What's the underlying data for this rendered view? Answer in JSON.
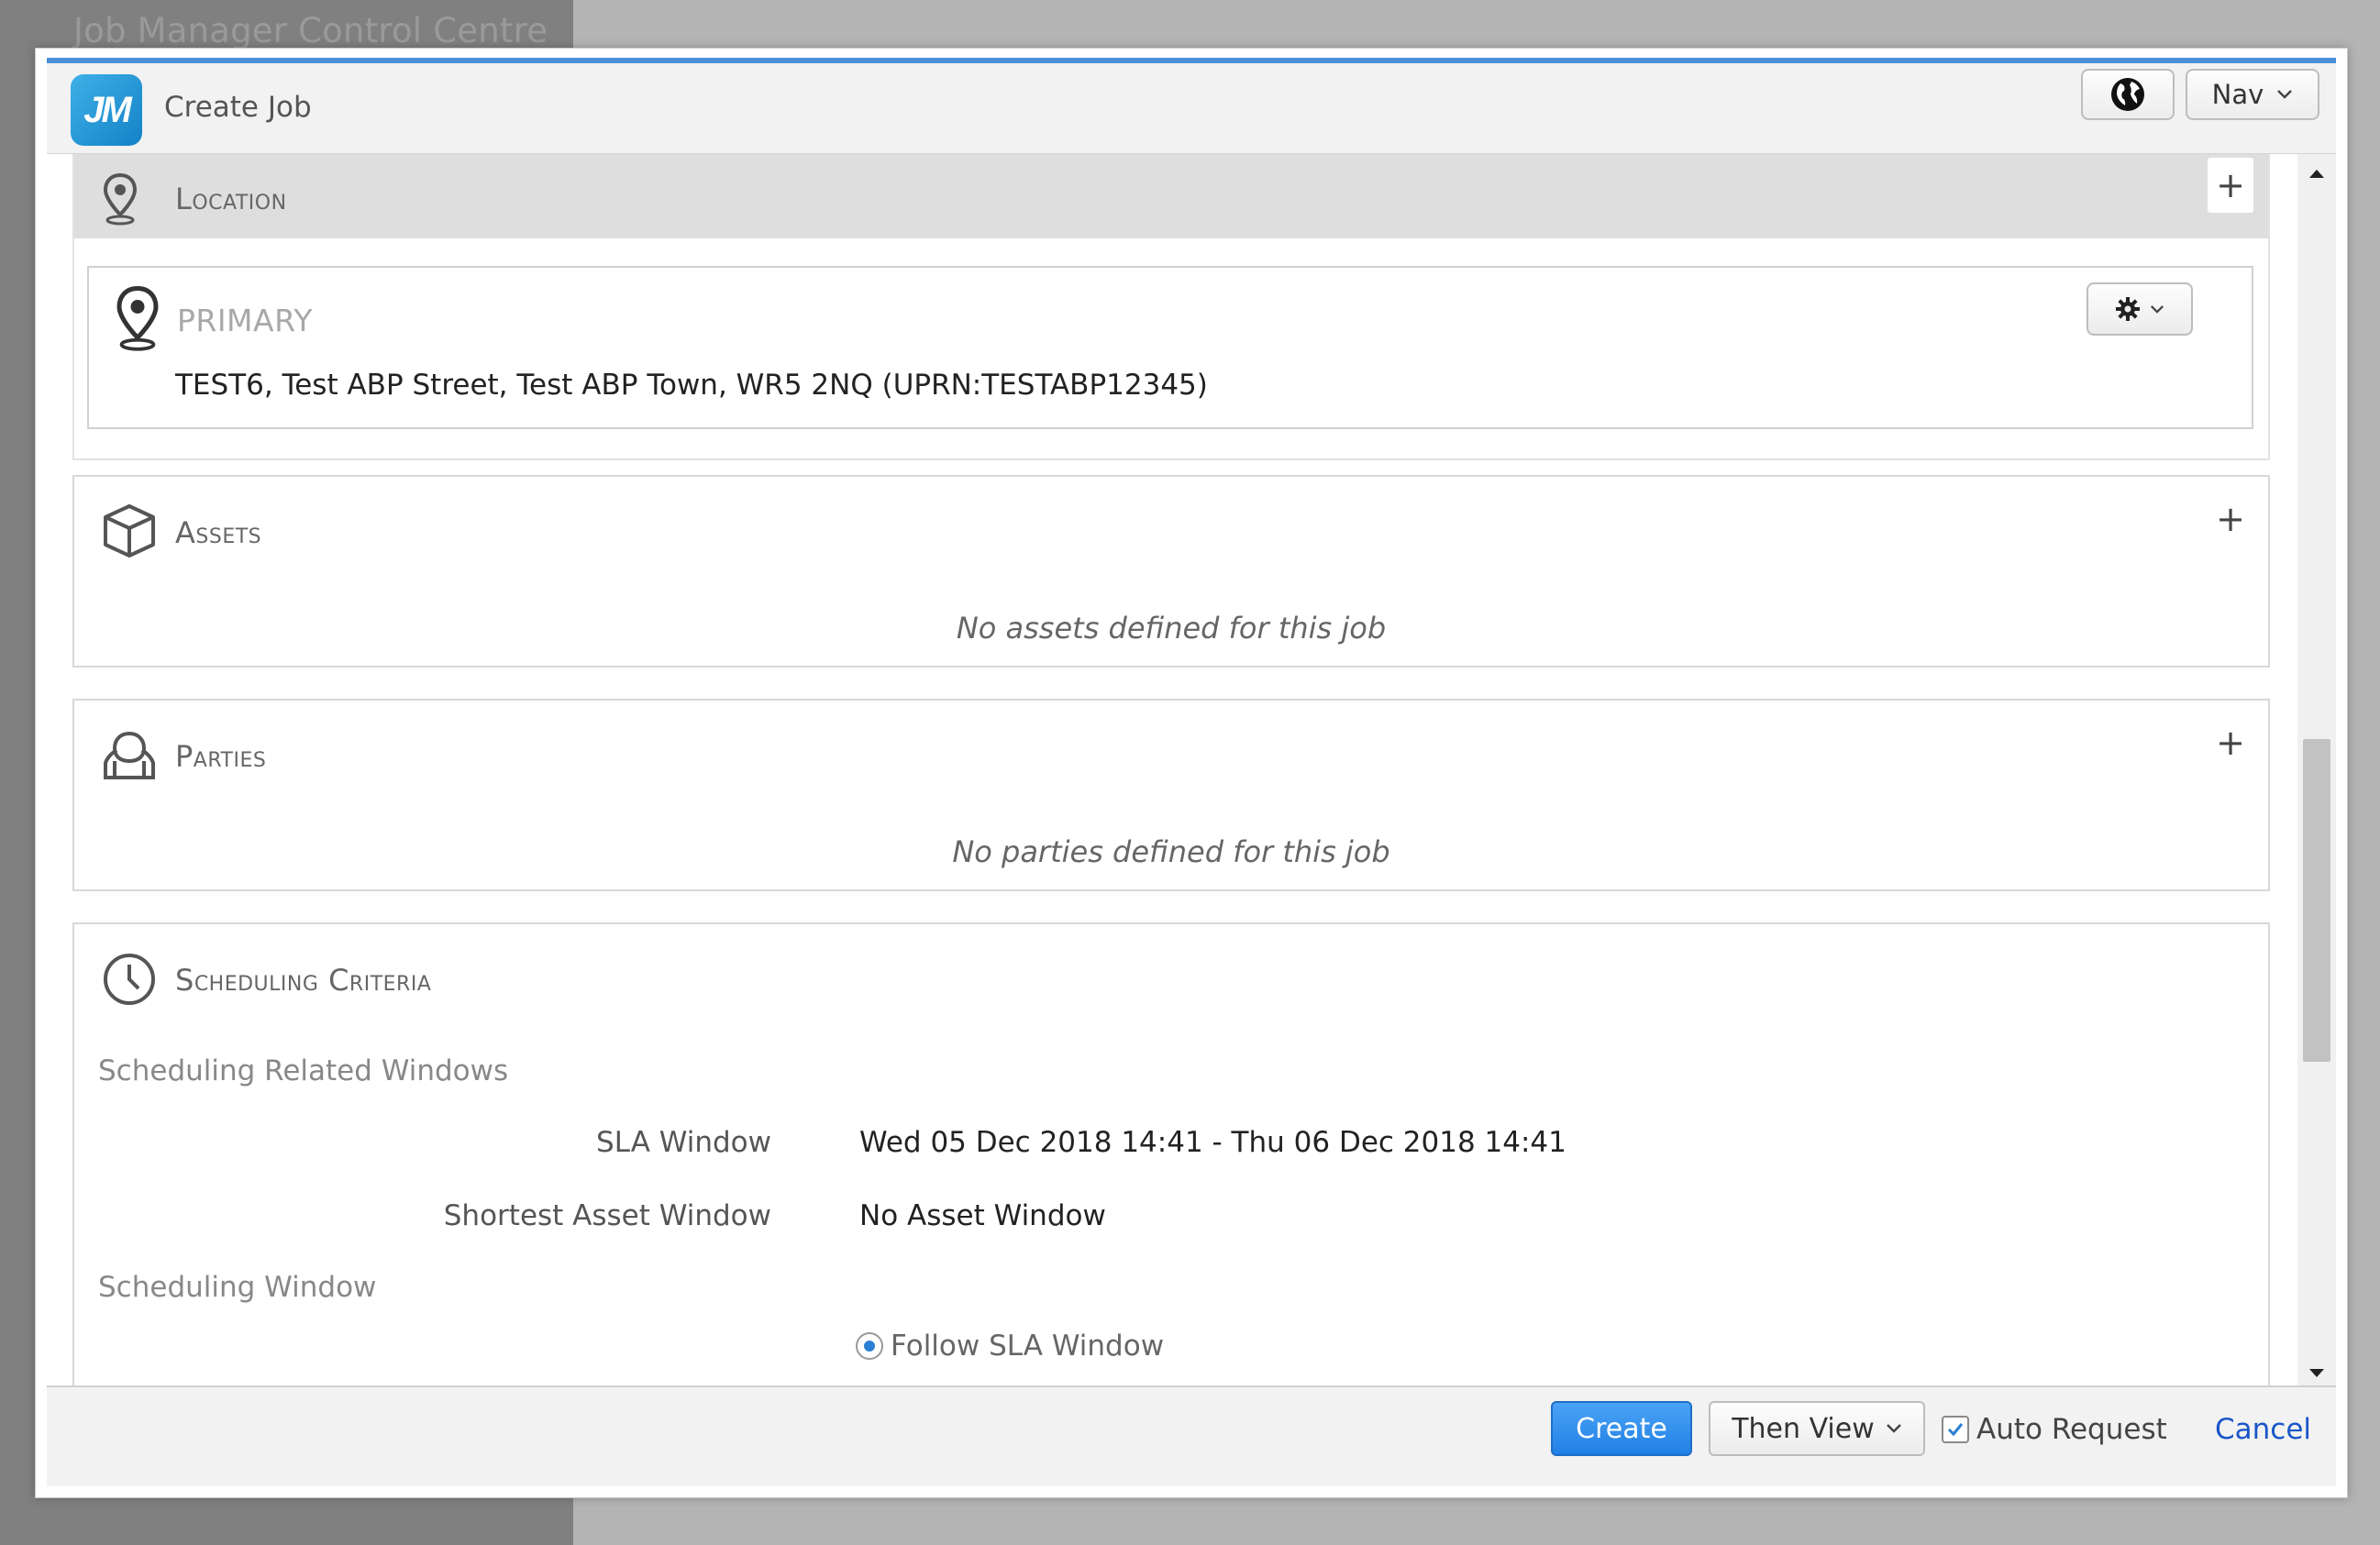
{
  "background": {
    "app_title": "Job Manager Control Centre"
  },
  "header": {
    "logo_text": "JM",
    "title": "Create Job",
    "nav_label": "Nav"
  },
  "location": {
    "title": "Location",
    "primary_label": "PRIMARY",
    "address": "TEST6, Test ABP Street, Test ABP Town, WR5 2NQ (UPRN:TESTABP12345)"
  },
  "assets": {
    "title": "Assets",
    "empty": "No assets defined for this job"
  },
  "parties": {
    "title": "Parties",
    "empty": "No parties defined for this job"
  },
  "scheduling": {
    "title": "Scheduling Criteria",
    "related_heading": "Scheduling Related Windows",
    "sla_label": "SLA Window",
    "sla_value": "Wed 05 Dec 2018 14:41 - Thu 06 Dec 2018 14:41",
    "asset_window_label": "Shortest Asset Window",
    "asset_window_value": "No Asset Window",
    "window_heading": "Scheduling Window",
    "follow_sla_label": "Follow SLA Window",
    "follow_sla_selected": true
  },
  "footer": {
    "create_label": "Create",
    "then_view_label": "Then View",
    "auto_request_label": "Auto Request",
    "auto_request_checked": true,
    "cancel_label": "Cancel"
  },
  "colors": {
    "accent": "#2180e6",
    "link": "#1a56c9",
    "topline": "#4a90d9"
  },
  "icons": [
    "globe-icon",
    "chevron-down-icon",
    "location-pin-icon",
    "plus-icon",
    "gear-icon",
    "box-icon",
    "person-icon",
    "clock-icon",
    "scroll-up-icon",
    "scroll-down-icon",
    "check-icon"
  ]
}
